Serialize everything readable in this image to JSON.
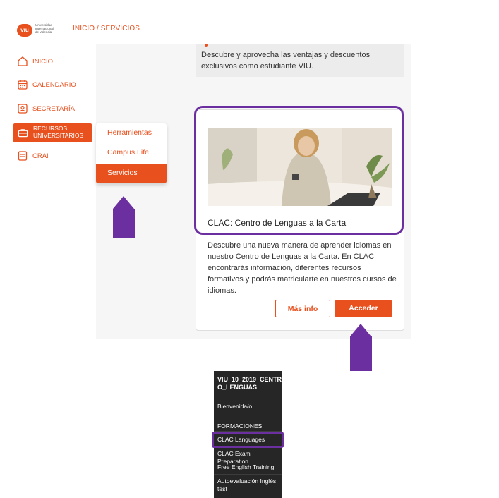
{
  "header": {
    "logo_text": "viu",
    "logo_lines": [
      "Universidad",
      "Internacional",
      "de Valencia"
    ],
    "breadcrumb": "INICIO / SERVICIOS"
  },
  "sidebar": {
    "items": [
      {
        "label": "INICIO",
        "icon": "home-icon"
      },
      {
        "label": "CALENDARIO",
        "icon": "calendar-icon"
      },
      {
        "label": "SECRETARÍA",
        "icon": "user-id-icon"
      },
      {
        "label": "RECURSOS UNIVERSITARIOS",
        "icon": "briefcase-icon",
        "active": true
      },
      {
        "label": "CRAI",
        "icon": "book-icon"
      }
    ]
  },
  "submenu": {
    "items": [
      "Herramientas",
      "Campus Life",
      "Servicios"
    ],
    "active": "Servicios"
  },
  "top_card": {
    "description": "Descubre y aprovecha las ventajas y descuentos exclusivos como estudiante VIU."
  },
  "card": {
    "title": "CLAC: Centro de Lenguas a la Carta",
    "description": "Descubre una nueva manera de aprender idiomas en nuestro Centro de Lenguas a la Carta. En CLAC encontrarás información, diferentes recursos formativos y podrás matricularte en nuestros cursos de idiomas.",
    "buttons": {
      "info": "Más info",
      "access": "Acceder"
    }
  },
  "dark_menu": {
    "title": "VIU_10_2019_CENTRO_LENGUAS",
    "items": [
      "Bienvenida/o",
      "FORMACIONES",
      "CLAC Languages",
      "CLAC Exam Preparation",
      "Free English Training",
      "Autoevaluación Inglés test"
    ],
    "highlighted": "CLAC Languages"
  },
  "colors": {
    "accent": "#e8501e",
    "highlight": "#6b2fa0",
    "dark_panel": "#262626"
  }
}
